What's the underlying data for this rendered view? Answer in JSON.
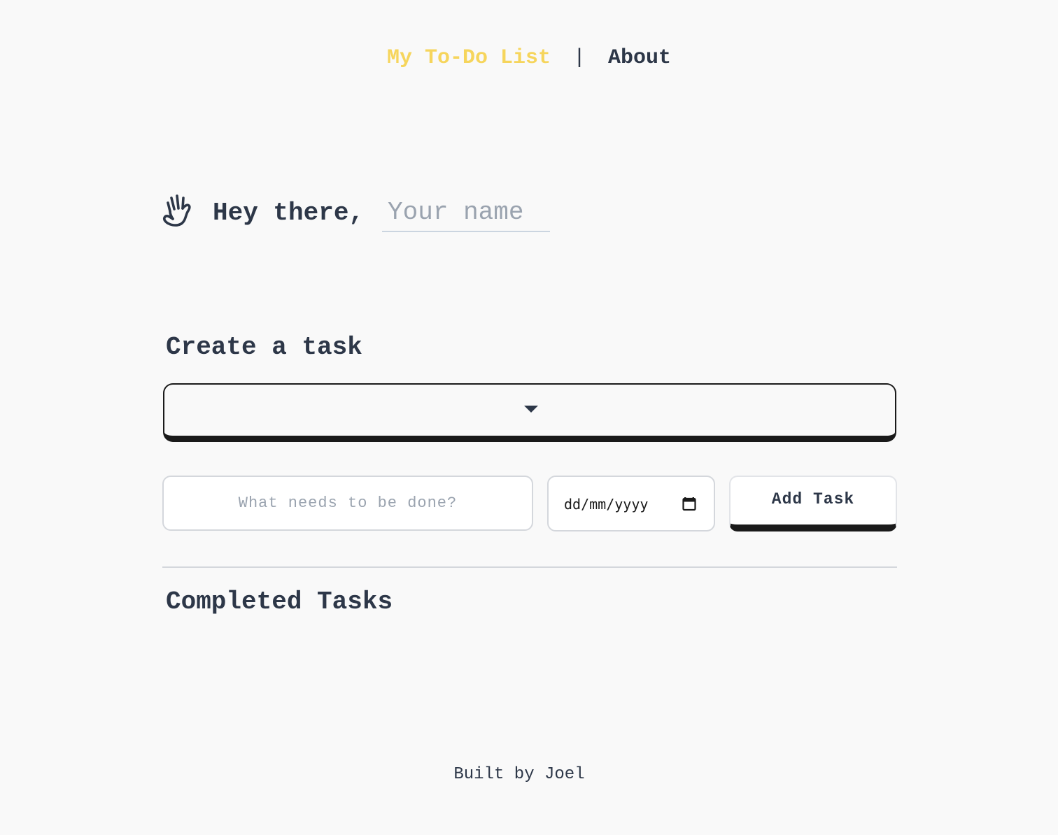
{
  "nav": {
    "home_label": "My To-Do List",
    "separator": "|",
    "about_label": "About",
    "home_color": "#f6d55c"
  },
  "greeting": {
    "icon": "hand-wave-icon",
    "text": "Hey there,",
    "name_placeholder": "Your name",
    "name_value": ""
  },
  "create": {
    "title": "Create a task",
    "category_select": {
      "selected_value": "",
      "icon": "caret-down-icon"
    },
    "task_placeholder": "What needs to be done?",
    "date_placeholder": "dd/mm/yyyy",
    "date_icon": "calendar-icon",
    "add_button_label": "Add Task"
  },
  "completed": {
    "title": "Completed Tasks",
    "items": []
  },
  "footer": {
    "text": "Built by Joel"
  },
  "colors": {
    "background": "#f9f9f9",
    "text": "#2d3748",
    "accent": "#f6d55c",
    "placeholder": "#9aa3af",
    "border_dark": "#1a1a1a"
  }
}
